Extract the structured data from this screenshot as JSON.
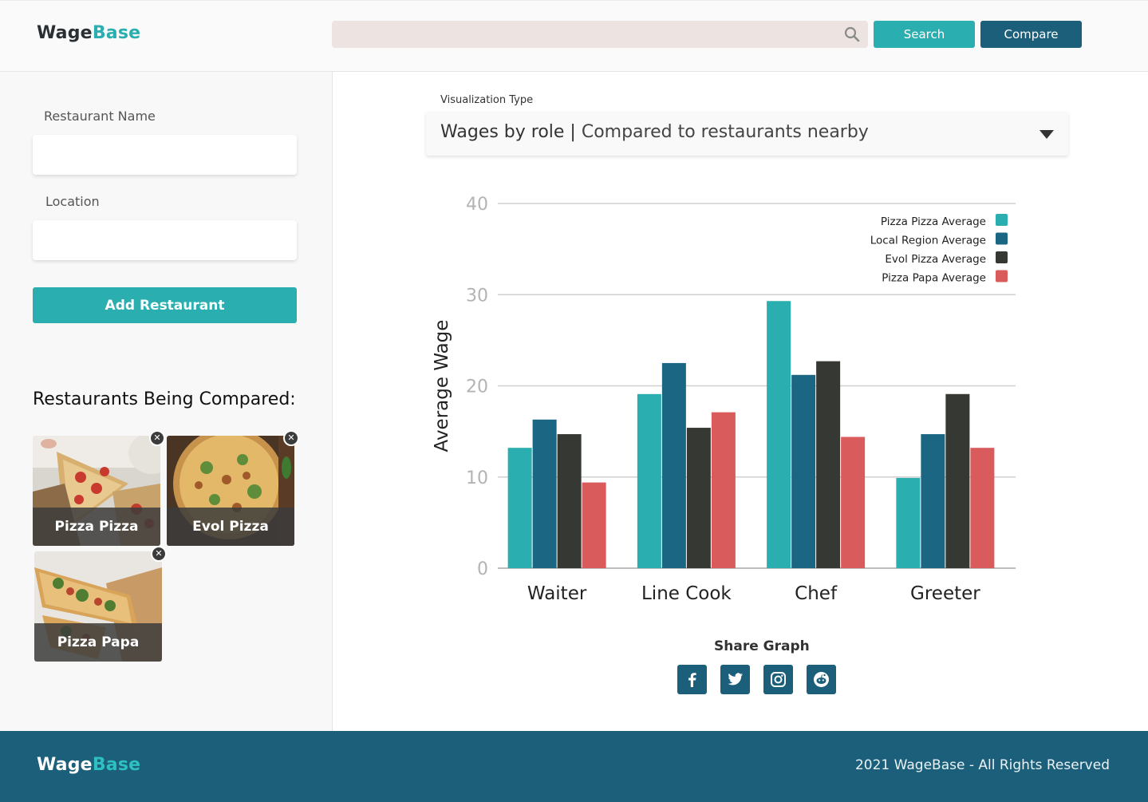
{
  "header": {
    "logo_part1": "Wage",
    "logo_part2": "Base",
    "search_placeholder": "",
    "search_label": "Search",
    "compare_label": "Compare"
  },
  "sidebar": {
    "restaurant_name_label": "Restaurant Name",
    "restaurant_name_value": "",
    "location_label": "Location",
    "location_value": "",
    "add_button": "Add Restaurant",
    "compared_title": "Restaurants Being Compared:",
    "restaurants": [
      {
        "name": "Pizza Pizza"
      },
      {
        "name": "Evol Pizza"
      },
      {
        "name": "Pizza Papa"
      }
    ]
  },
  "main": {
    "visualization_label": "Visualization Type",
    "visualization_main": "Wages by role",
    "visualization_separator": " | ",
    "visualization_sub": "Compared to restaurants nearby",
    "share_title": "Share Graph",
    "share_icons": [
      "facebook-icon",
      "twitter-icon",
      "instagram-icon",
      "reddit-icon"
    ]
  },
  "chart_data": {
    "type": "bar",
    "title": "",
    "xlabel": "",
    "ylabel": "Average Wage",
    "ylim": [
      0,
      40
    ],
    "yticks": [
      0,
      10,
      20,
      30,
      40
    ],
    "grid": true,
    "legend_position": "top-right",
    "categories": [
      "Waiter",
      "Line Cook",
      "Chef",
      "Greeter"
    ],
    "series": [
      {
        "name": "Pizza Pizza Average",
        "color": "#2aaeaf",
        "values": [
          13.2,
          19.1,
          29.3,
          9.9
        ]
      },
      {
        "name": "Local Region Average",
        "color": "#1b6682",
        "values": [
          16.3,
          22.5,
          21.2,
          14.7
        ]
      },
      {
        "name": "Evol Pizza Average",
        "color": "#363833",
        "values": [
          14.7,
          15.4,
          22.7,
          19.1
        ]
      },
      {
        "name": "Pizza Papa Average",
        "color": "#d95b5b",
        "values": [
          9.4,
          17.1,
          14.4,
          13.2
        ]
      }
    ]
  },
  "footer": {
    "logo_part1": "Wage",
    "logo_part2": "Base",
    "copyright": "2021 WageBase - All Rights Reserved"
  }
}
